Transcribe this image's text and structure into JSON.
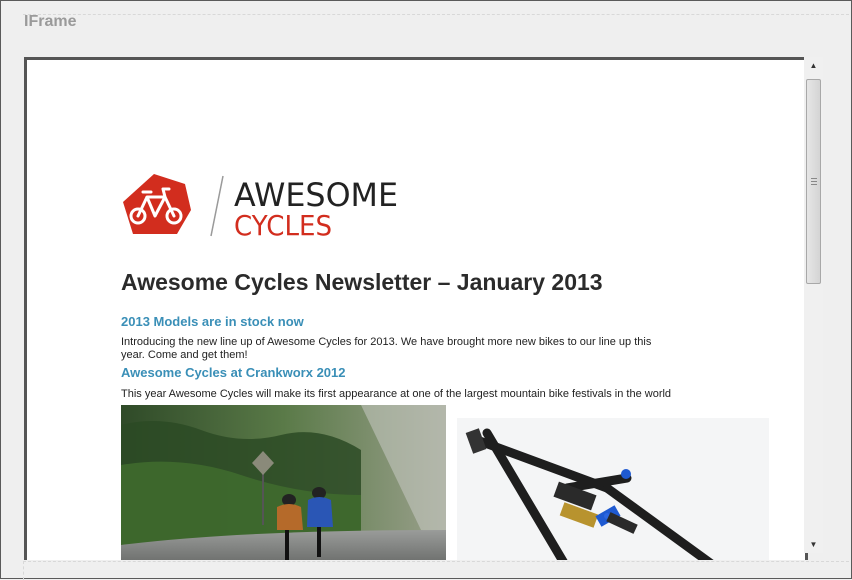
{
  "panel": {
    "title": "IFrame"
  },
  "newsletter": {
    "logo": {
      "line1": "AWESOME",
      "line2": "CYCLES"
    },
    "title": "Awesome Cycles Newsletter – January 2013",
    "sections": [
      {
        "heading": "2013 Models are in stock now",
        "text_line1": "Introducing the new line up of Awesome Cycles for 2013. We have brought more new bikes to our line up this",
        "text_line2": "year. Come and get them!"
      },
      {
        "heading": "Awesome Cycles at Crankworx 2012",
        "text_line1": "This year Awesome Cycles will make its first appearance at one of the largest mountain bike festivals in the world"
      }
    ]
  },
  "colors": {
    "brand_red": "#d22d1e",
    "link_blue": "#3a8fb7",
    "frame_border": "#555555"
  }
}
